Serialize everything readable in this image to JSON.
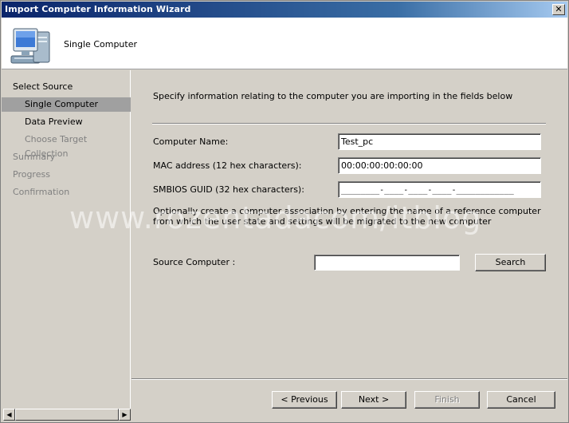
{
  "window": {
    "title": "Import Computer Information Wizard",
    "close_glyph": "✕"
  },
  "header": {
    "title": "Single Computer",
    "icon": "computer-icon"
  },
  "nav": {
    "items": [
      {
        "label": "Select Source",
        "state": "enabled"
      },
      {
        "label": "Single Computer",
        "state": "selected"
      },
      {
        "label": "Data Preview",
        "state": "enabled"
      },
      {
        "label": "Choose Target Collection",
        "state": "disabled"
      },
      {
        "label": "Summary",
        "state": "disabled"
      },
      {
        "label": "Progress",
        "state": "disabled"
      },
      {
        "label": "Confirmation",
        "state": "disabled"
      }
    ]
  },
  "main": {
    "intro": "Specify information relating to the computer you are importing in the fields below",
    "computer_name_label": "Computer Name:",
    "computer_name_value": "Test_pc",
    "mac_label": "MAC address (12 hex characters):",
    "mac_value": "00:00:00:00:00:00",
    "guid_label": "SMBIOS GUID (32 hex characters):",
    "guid_mask": "________-____-____-____-____________",
    "note": "Optionally create a computer association by entering the name of a reference computer from which the user state and settings will be migrated to the new computer",
    "source_label": "Source Computer :",
    "source_value": "",
    "search_button": "Search"
  },
  "watermark": "www.rozentadacom/itblog",
  "footer": {
    "previous": "< Previous",
    "next": "Next >",
    "finish": "Finish",
    "cancel": "Cancel"
  },
  "scrollbar": {
    "left_glyph": "◀",
    "right_glyph": "▶"
  }
}
